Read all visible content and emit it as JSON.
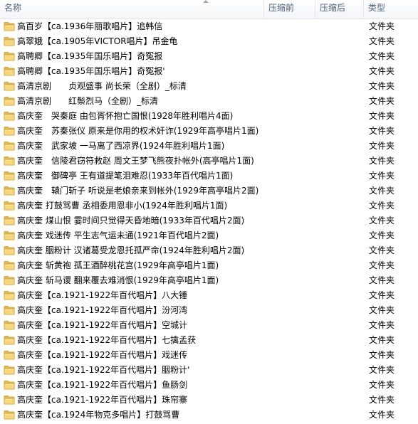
{
  "columns": {
    "name": "名称",
    "compressed": "压缩前",
    "compressed_after": "压缩后",
    "type": "类型"
  },
  "rows": [
    {
      "name": "高百岁【ca.1936年丽歌唱片】追韩信",
      "type": "文件夹"
    },
    {
      "name": "高翠娥【ca.1905年VICTOR唱片】吊金龟",
      "type": "文件夹"
    },
    {
      "name": "高聘卿【ca.1935年国乐唱片】奇冤报",
      "type": "文件夹"
    },
    {
      "name": "高聘卿【ca.1935年国乐唱片】奇冤报'",
      "type": "文件夹"
    },
    {
      "name": "高清京剧　　贞观盛事 尚长荣（全剧）_标清",
      "type": "文件夹"
    },
    {
      "name": "高清京剧　　红鬃烈马（全剧）_标清",
      "type": "文件夹"
    },
    {
      "name": "高庆奎　哭秦庭 由包胥怀抱亡国恨(1928年胜利唱片4面)",
      "type": "文件夹"
    },
    {
      "name": "高庆奎　苏秦张仪 原来是你用的权术奸诈(1929年高亭唱片1面)",
      "type": "文件夹"
    },
    {
      "name": "高庆奎　武家坡 一马离了西凉界(1924年胜利唱片1面)",
      "type": "文件夹"
    },
    {
      "name": "高庆奎　信陵君窃符救赵 周文王梦飞熊夜扑帐外(高亭唱片1面)",
      "type": "文件夹"
    },
    {
      "name": "高庆奎　御碑亭 王有道提笔泪难忍(1933年百代唱片1面)",
      "type": "文件夹"
    },
    {
      "name": "高庆奎　辕门斩子 听说是老娘亲来到帐外(1929年高亭唱片2面)",
      "type": "文件夹"
    },
    {
      "name": "高庆奎 打鼓骂曹 丞相委用恩非小(1924年胜利唱片1面)",
      "type": "文件夹"
    },
    {
      "name": "高庆奎 煤山恨 霎时间只觉得天昏地暗(1933年百代唱片2面)",
      "type": "文件夹"
    },
    {
      "name": "高庆奎 戏迷传 平生志气运未通(1921年百代唱片2面)",
      "type": "文件夹"
    },
    {
      "name": "高庆奎 胭粉计 汉诸葛受龙恩托孤严命(1924年胜利唱片2面)",
      "type": "文件夹"
    },
    {
      "name": "高庆奎 斩黄袍 孤王酒醉桃花宫(1929年高亭唱片1面)",
      "type": "文件夹"
    },
    {
      "name": "高庆奎 斩马谡 翻来覆去难消恨(1929年高亭唱片1面)",
      "type": "文件夹"
    },
    {
      "name": "高庆奎【ca.1921-1922年百代唱片】八大锤",
      "type": "文件夹"
    },
    {
      "name": "高庆奎【ca.1921-1922年百代唱片】汾河湾",
      "type": "文件夹"
    },
    {
      "name": "高庆奎【ca.1921-1922年百代唱片】空城计",
      "type": "文件夹"
    },
    {
      "name": "高庆奎【ca.1921-1922年百代唱片】七擒孟获",
      "type": "文件夹"
    },
    {
      "name": "高庆奎【ca.1921-1922年百代唱片】戏迷传",
      "type": "文件夹"
    },
    {
      "name": "高庆奎【ca.1921-1922年百代唱片】胭粉计'",
      "type": "文件夹"
    },
    {
      "name": "高庆奎【ca.1921-1922年百代唱片】鱼肠剑",
      "type": "文件夹"
    },
    {
      "name": "高庆奎【ca.1921-1922年百代唱片】珠帘寨",
      "type": "文件夹"
    },
    {
      "name": "高庆奎【ca.1924年物克多唱片】打鼓骂曹",
      "type": "文件夹"
    }
  ]
}
